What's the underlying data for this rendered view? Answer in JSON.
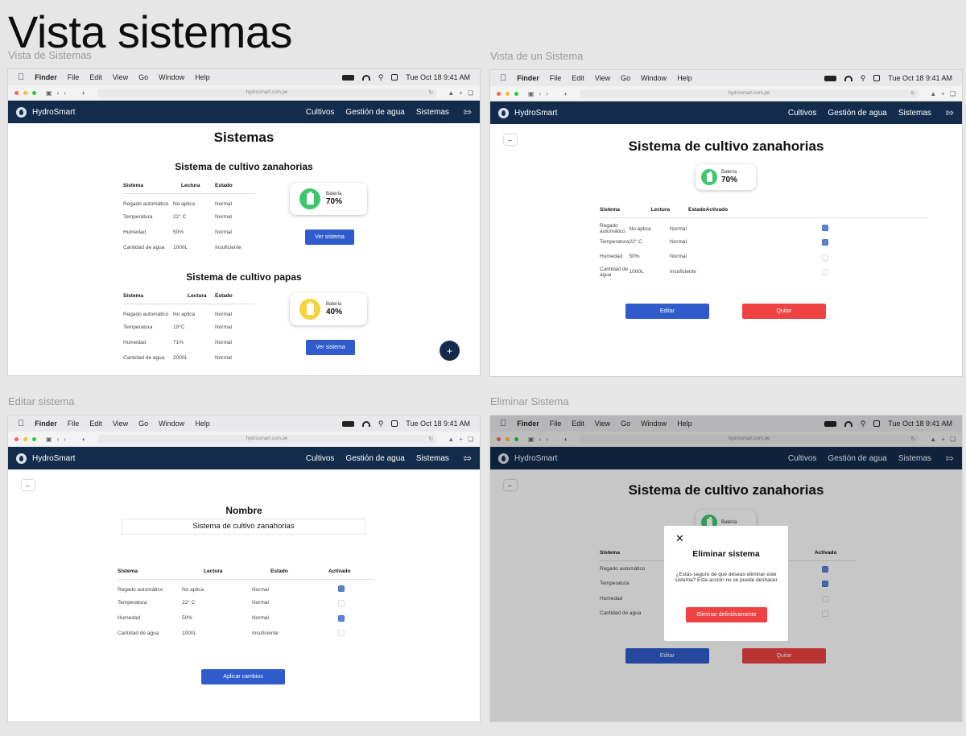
{
  "page_title": "Vista sistemas",
  "frame_labels": [
    "Vista de Sistemas",
    "Vista de un Sistema",
    "Editar sistema",
    "Eliminar Sistema"
  ],
  "mac": {
    "finder": "Finder",
    "menus": [
      "File",
      "Edit",
      "View",
      "Go",
      "Window",
      "Help"
    ],
    "datetime": "Tue Oct 18  9:41 AM"
  },
  "browser": {
    "url": "hydrosmart.com.pe"
  },
  "app": {
    "brand": "HydroSmart",
    "nav": [
      "Cultivos",
      "Gestión de agua",
      "Sistemas"
    ]
  },
  "colors": {
    "navbar": "#142c4c",
    "primary": "#2f5bcc",
    "danger": "#ef4343",
    "battery_green": "#3ec66c",
    "battery_yellow": "#f6d23c"
  },
  "vista_sistemas": {
    "heading": "Sistemas",
    "systems": [
      {
        "title": "Sistema de cultivo zanahorias",
        "headers": [
          "Sistema",
          "Lectura",
          "Estado"
        ],
        "rows": [
          [
            "Regado automático",
            "No aplica",
            "Normal"
          ],
          [
            "Temperatura",
            "22° C",
            "Normal"
          ],
          [
            "Humedad",
            "50%",
            "Normal"
          ],
          [
            "Cantidad de agua",
            "1000L",
            "Insuficiente"
          ]
        ],
        "battery_label": "Batería",
        "battery_value": "70%",
        "battery_level": 0.7,
        "button": "Ver sistema"
      },
      {
        "title": "Sistema de cultivo papas",
        "headers": [
          "Sistema",
          "Lectura",
          "Estado"
        ],
        "rows": [
          [
            "Regado automático",
            "No aplica",
            "Normal"
          ],
          [
            "Temperatura",
            "19°C",
            "Normal"
          ],
          [
            "Humedad",
            "71%",
            "Normal"
          ],
          [
            "Cantidad de agua",
            "2000L",
            "Normal"
          ]
        ],
        "battery_label": "Batería",
        "battery_value": "40%",
        "battery_level": 0.4,
        "button": "Ver sistema"
      }
    ],
    "fab": "+"
  },
  "vista_un_sistema": {
    "title": "Sistema de cultivo zanahorias",
    "battery_label": "Batería",
    "battery_value": "70%",
    "headers": [
      "Sistema",
      "Lectura",
      "Estado",
      "Activado"
    ],
    "rows": [
      [
        "Regado automático",
        "No aplica",
        "Normal"
      ],
      [
        "Temperatura",
        "22° C",
        "Normal"
      ],
      [
        "Humedad",
        "50%",
        "Normal"
      ],
      [
        "Cantidad de agua",
        "1000L",
        "Insuficiente"
      ]
    ],
    "activated": [
      true,
      true,
      false,
      false
    ],
    "edit_button": "Editar",
    "remove_button": "Quitar"
  },
  "editar_sistema": {
    "name_label": "Nombre",
    "name_value": "Sistema de cultivo zanahorias",
    "headers": [
      "Sistema",
      "Lectura",
      "Estado",
      "Activado"
    ],
    "rows": [
      [
        "Regado automático",
        "No aplica",
        "Normal"
      ],
      [
        "Temperatura",
        "22° C",
        "Normal"
      ],
      [
        "Humedad",
        "50%",
        "Normal"
      ],
      [
        "Cantidad de agua",
        "1000L",
        "Insuficiente"
      ]
    ],
    "activated": [
      true,
      false,
      true,
      false
    ],
    "apply_button": "Aplicar cambios"
  },
  "eliminar_sistema": {
    "title": "Sistema de cultivo zanahorias",
    "battery_label": "Batería",
    "headers": [
      "Sistema",
      "Activado"
    ],
    "rows": [
      "Regado automático",
      "Temperatura",
      "Humedad",
      "Cantidad de agua"
    ],
    "activated": [
      true,
      true,
      false,
      false
    ],
    "edit_button": "Editar",
    "remove_button": "Quitar",
    "modal": {
      "close": "✕",
      "title": "Eliminar sistema",
      "body": "¿Estás seguro de que deseas eliminar este sistema? Esta acción no se puede deshacer",
      "confirm": "Eliminar definitivamente"
    }
  }
}
